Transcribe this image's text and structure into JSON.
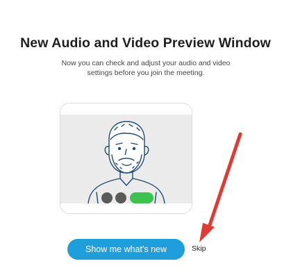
{
  "dialog": {
    "title": "New Audio and Video Preview Window",
    "subtitle": "Now you can check and adjust your audio and video settings before you join the meeting."
  },
  "preview": {
    "illustration": "avatar-illustration",
    "controls": [
      {
        "name": "mic-toggle",
        "state": "off",
        "color": "#5a5a5a"
      },
      {
        "name": "camera-toggle",
        "state": "off",
        "color": "#5a5a5a"
      },
      {
        "name": "join-indicator",
        "state": "on",
        "color": "#3dc24f"
      }
    ]
  },
  "actions": {
    "primary_label": "Show me what's new",
    "skip_label": "Skip"
  },
  "colors": {
    "accent": "#1e9fdc",
    "annotation_arrow": "#e03a36",
    "line_art": "#1c4b73"
  },
  "annotation": {
    "type": "arrow",
    "points_to": "skip-link"
  }
}
